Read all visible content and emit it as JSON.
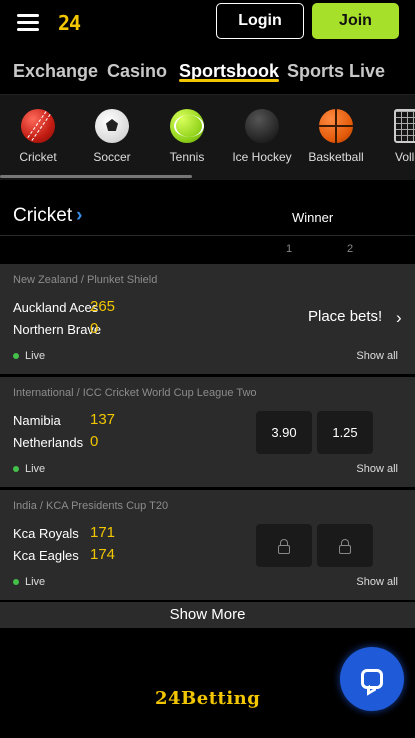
{
  "header": {
    "logo": "24",
    "login_label": "Login",
    "join_label": "Join"
  },
  "main_tabs": [
    {
      "label": "Exchange"
    },
    {
      "label": "Casino"
    },
    {
      "label": "Sportsbook",
      "active": true
    },
    {
      "label": "Sports Live"
    }
  ],
  "sports": [
    {
      "label": "Cricket",
      "icon": "cricket-ball-icon"
    },
    {
      "label": "Soccer",
      "icon": "soccer-ball-icon"
    },
    {
      "label": "Tennis",
      "icon": "tennis-ball-icon"
    },
    {
      "label": "Ice Hockey",
      "icon": "hockey-puck-icon"
    },
    {
      "label": "Basketball",
      "icon": "basketball-icon"
    },
    {
      "label": "Volley",
      "icon": "volleyball-net-icon"
    }
  ],
  "section": {
    "title": "Cricket",
    "market_label": "Winner",
    "col1": "1",
    "col2": "2"
  },
  "matches": [
    {
      "league": "New Zealand / Plunket Shield",
      "team1": "Auckland Aces",
      "score1": "265",
      "team2": "Northern Brave",
      "score2": "0",
      "status": "Live",
      "show_all": "Show all",
      "place_bets": "Place bets!"
    },
    {
      "league": "International / ICC Cricket World Cup League Two",
      "team1": "Namibia",
      "score1": "137",
      "team2": "Netherlands",
      "score2": "0",
      "status": "Live",
      "show_all": "Show all",
      "odd1": "3.90",
      "odd2": "1.25"
    },
    {
      "league": "India / KCA Presidents Cup T20",
      "team1": "Kca Royals",
      "score1": "171",
      "team2": "Kca Eagles",
      "score2": "174",
      "status": "Live",
      "show_all": "Show all",
      "locked": true
    }
  ],
  "show_more_label": "Show More",
  "footer": {
    "brand": "24Betting"
  },
  "colors": {
    "accent": "#f2c600",
    "join": "#a7e02a",
    "live_dot": "#43c04a",
    "chat": "#1f5bd8"
  }
}
